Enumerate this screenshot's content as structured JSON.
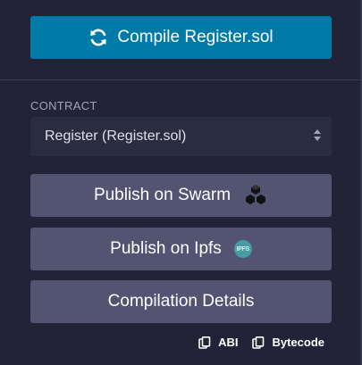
{
  "compile": {
    "label": "Compile Register.sol",
    "icon": "refresh-icon"
  },
  "contract": {
    "label": "CONTRACT",
    "selected": "Register (Register.sol)"
  },
  "actions": {
    "swarm": {
      "label": "Publish on Swarm",
      "icon": "swarm-icon"
    },
    "ipfs": {
      "label": "Publish on Ipfs",
      "icon": "ipfs-icon",
      "badge_text": "IPFS"
    },
    "details": {
      "label": "Compilation Details"
    }
  },
  "footer": {
    "abi": {
      "label": "ABI",
      "icon": "copy-icon"
    },
    "bytecode": {
      "label": "Bytecode",
      "icon": "copy-icon"
    }
  },
  "colors": {
    "accent": "#007aa6",
    "button": "#535372",
    "background": "#222336"
  }
}
